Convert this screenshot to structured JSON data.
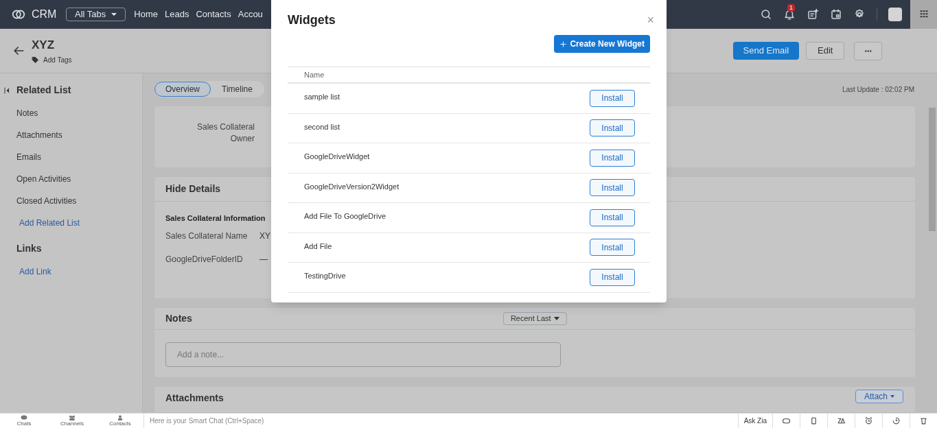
{
  "topbar": {
    "brand": "CRM",
    "all_tabs": "All Tabs",
    "nav": [
      "Home",
      "Leads",
      "Contacts",
      "Accou"
    ],
    "notification_count": "1"
  },
  "record": {
    "title": "XYZ",
    "add_tags": "Add Tags",
    "buttons": [
      "Send Email",
      "Edit",
      "•••"
    ]
  },
  "sidebar": {
    "sections": [
      {
        "title": "Related List",
        "items": [
          "Notes",
          "Attachments",
          "Emails",
          "Open Activities",
          "Closed Activities"
        ],
        "link": "Add Related List"
      },
      {
        "title": "Links",
        "link": "Add Link"
      }
    ]
  },
  "tabs": [
    {
      "label": "Overview",
      "selected": true
    },
    {
      "label": "Timeline",
      "selected": false
    }
  ],
  "last_update": "Last Update : 02:02 PM",
  "summary": {
    "label": "Sales Collateral Owner"
  },
  "details": {
    "title": "Hide Details",
    "section": "Sales Collateral Information",
    "fields": [
      {
        "label": "Sales Collateral Name",
        "value": "XY"
      },
      {
        "label": "GoogleDriveFolderID",
        "value": "—"
      }
    ]
  },
  "notes": {
    "title": "Notes",
    "sort": "Recent Last",
    "placeholder": "Add a note..."
  },
  "attachments": {
    "title": "Attachments",
    "button": "Attach"
  },
  "bottom_bar": {
    "items": [
      "Chats",
      "Channels",
      "Contacts"
    ],
    "chat_placeholder": "Here is your Smart Chat (Ctrl+Space)",
    "ask_zia": "Ask Zia"
  },
  "modal": {
    "title": "Widgets",
    "close": "×",
    "create_button": "Create New Widget",
    "column": "Name",
    "rows": [
      {
        "name": "sample list",
        "action": "Install"
      },
      {
        "name": "second list",
        "action": "Install"
      },
      {
        "name": "GoogleDriveWidget",
        "action": "Install"
      },
      {
        "name": "GoogleDriveVersion2Widget",
        "action": "Install"
      },
      {
        "name": "Add File To GoogleDrive",
        "action": "Install"
      },
      {
        "name": "Add File",
        "action": "Install"
      },
      {
        "name": "TestingDrive",
        "action": "Install"
      }
    ]
  }
}
